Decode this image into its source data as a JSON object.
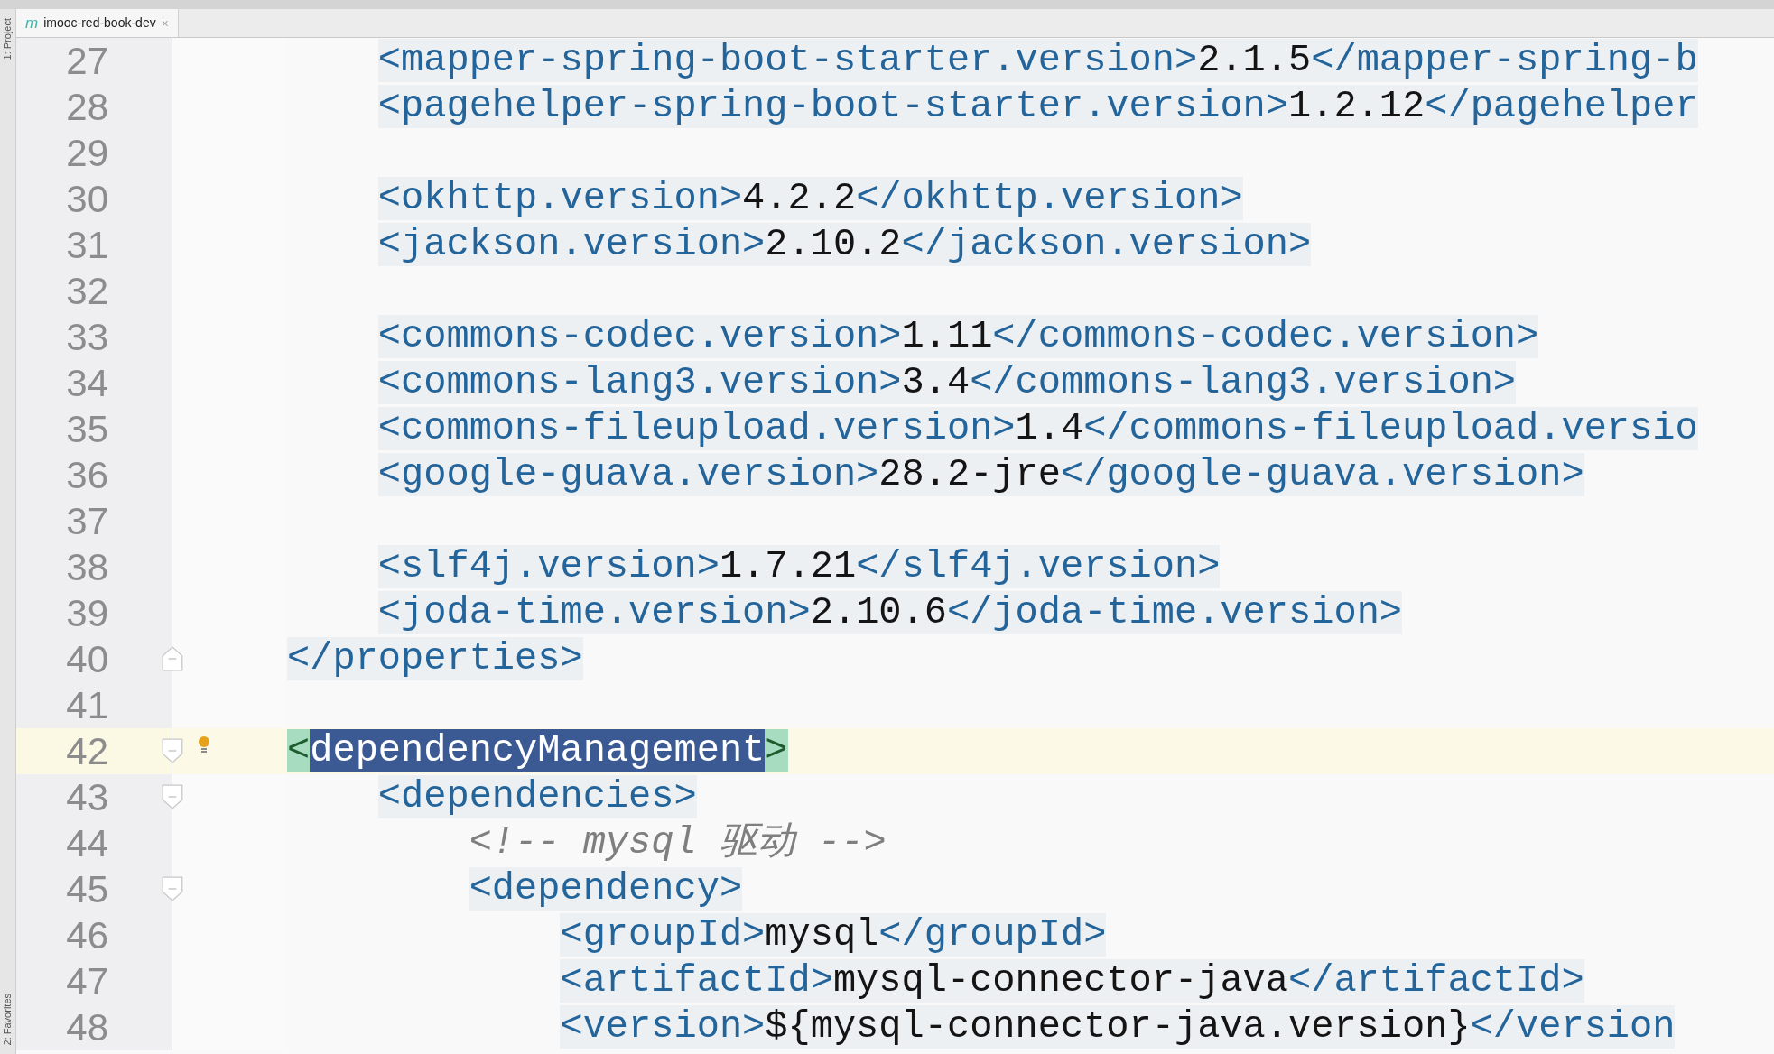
{
  "tool_strip": [
    {
      "label": "1: Project"
    },
    {
      "label": "2: Favorites"
    }
  ],
  "tab": {
    "icon_letter": "m",
    "title": "imooc-red-book-dev",
    "close": "×"
  },
  "lines": [
    {
      "number": "27",
      "current": false,
      "segments": [
        {
          "kind": "tag",
          "text": "    <mapper-spring-boot-starter.version>"
        },
        {
          "kind": "text",
          "text": "2.1.5"
        },
        {
          "kind": "tag",
          "text": "</mapper-spring-b"
        }
      ]
    },
    {
      "number": "28",
      "current": false,
      "segments": [
        {
          "kind": "tag",
          "text": "    <pagehelper-spring-boot-starter.version>"
        },
        {
          "kind": "text",
          "text": "1.2.12"
        },
        {
          "kind": "tag",
          "text": "</pagehelper"
        }
      ]
    },
    {
      "number": "29",
      "current": false
    },
    {
      "number": "30",
      "current": false,
      "segments": [
        {
          "kind": "tag",
          "text": "    <okhttp.version>"
        },
        {
          "kind": "text",
          "text": "4.2.2"
        },
        {
          "kind": "tag",
          "text": "</okhttp.version>"
        }
      ]
    },
    {
      "number": "31",
      "current": false,
      "segments": [
        {
          "kind": "tag",
          "text": "    <jackson.version>"
        },
        {
          "kind": "text",
          "text": "2.10.2"
        },
        {
          "kind": "tag",
          "text": "</jackson.version>"
        }
      ]
    },
    {
      "number": "32",
      "current": false
    },
    {
      "number": "33",
      "current": false,
      "segments": [
        {
          "kind": "tag",
          "text": "    <commons-codec.version>"
        },
        {
          "kind": "text",
          "text": "1.11"
        },
        {
          "kind": "tag",
          "text": "</commons-codec.version>"
        }
      ]
    },
    {
      "number": "34",
      "current": false,
      "segments": [
        {
          "kind": "tag",
          "text": "    <commons-lang3.version>"
        },
        {
          "kind": "text",
          "text": "3.4"
        },
        {
          "kind": "tag",
          "text": "</commons-lang3.version>"
        }
      ]
    },
    {
      "number": "35",
      "current": false,
      "segments": [
        {
          "kind": "tag",
          "text": "    <commons-fileupload.version>"
        },
        {
          "kind": "text",
          "text": "1.4"
        },
        {
          "kind": "tag",
          "text": "</commons-fileupload.versio"
        }
      ]
    },
    {
      "number": "36",
      "current": false,
      "segments": [
        {
          "kind": "tag",
          "text": "    <google-guava.version>"
        },
        {
          "kind": "text",
          "text": "28.2-jre"
        },
        {
          "kind": "tag",
          "text": "</google-guava.version>"
        }
      ]
    },
    {
      "number": "37",
      "current": false
    },
    {
      "number": "38",
      "current": false,
      "segments": [
        {
          "kind": "tag",
          "text": "    <slf4j.version>"
        },
        {
          "kind": "text",
          "text": "1.7.21"
        },
        {
          "kind": "tag",
          "text": "</slf4j.version>"
        }
      ]
    },
    {
      "number": "39",
      "current": false,
      "segments": [
        {
          "kind": "tag",
          "text": "    <joda-time.version>"
        },
        {
          "kind": "text",
          "text": "2.10.6"
        },
        {
          "kind": "tag",
          "text": "</joda-time.version>"
        }
      ]
    },
    {
      "number": "40",
      "current": false,
      "fold_end": true,
      "segments": [
        {
          "kind": "tag",
          "text": "</properties>"
        }
      ]
    },
    {
      "number": "41",
      "current": false
    },
    {
      "number": "42",
      "current": true,
      "fold_start": true,
      "bulb": true,
      "segments": [
        {
          "kind": "match",
          "text": "<"
        },
        {
          "kind": "selected",
          "text": "dependencyManagement"
        },
        {
          "kind": "match",
          "text": ">"
        }
      ]
    },
    {
      "number": "43",
      "current": false,
      "fold_start": true,
      "segments": [
        {
          "kind": "tag",
          "text": "    <dependencies>"
        }
      ]
    },
    {
      "number": "44",
      "current": false,
      "segments": [
        {
          "kind": "comment",
          "text": "        <!-- mysql 驱动 -->"
        }
      ]
    },
    {
      "number": "45",
      "current": false,
      "fold_start": true,
      "segments": [
        {
          "kind": "tag",
          "text": "        <dependency>"
        }
      ]
    },
    {
      "number": "46",
      "current": false,
      "segments": [
        {
          "kind": "tag",
          "text": "            <groupId>"
        },
        {
          "kind": "text",
          "text": "mysql"
        },
        {
          "kind": "tag",
          "text": "</groupId>"
        }
      ]
    },
    {
      "number": "47",
      "current": false,
      "segments": [
        {
          "kind": "tag",
          "text": "            <artifactId>"
        },
        {
          "kind": "text",
          "text": "mysql-connector-java"
        },
        {
          "kind": "tag",
          "text": "</artifactId>"
        }
      ]
    },
    {
      "number": "48",
      "current": false,
      "segments": [
        {
          "kind": "tag",
          "text": "            <version>"
        },
        {
          "kind": "text",
          "text": "${mysql-connector-java.version}"
        },
        {
          "kind": "tag",
          "text": "</version"
        }
      ]
    }
  ]
}
